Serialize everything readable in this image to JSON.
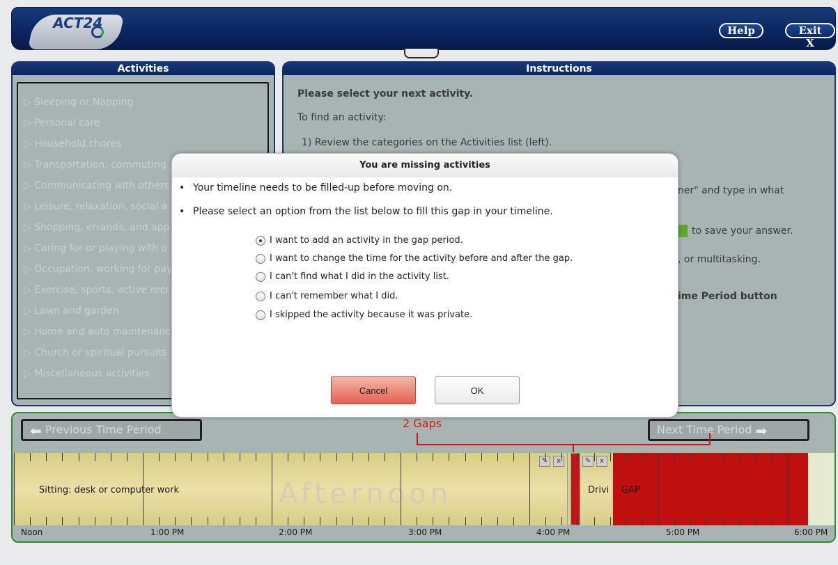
{
  "header": {
    "logo_text": "ACT24",
    "help_label": "Help",
    "exit_label": "Exit X"
  },
  "activities": {
    "title": "Activities",
    "items": [
      "▷ Sleeping or Napping",
      "▷ Personal care",
      "▷ Household chores",
      "▷ Transportation, commuting",
      "▷ Communicating with others",
      "▷ Leisure, relaxation, social a",
      "▷ Shopping, errands, and app",
      "▷ Caring for or playing with o",
      "▷ Occupation, working for pay",
      "▷ Exercise, sports, active recr",
      "▷ Lawn and garden",
      "▷ Home and auto maintenanc",
      "▷ Church or spiritual pursuits",
      "▷ Miscellaneous activities"
    ]
  },
  "instructions": {
    "title": "Instructions",
    "line1": "Please select your next activity.",
    "line2": "To find an activity:",
    "line3": "1) Review the categories on the Activities list (left).",
    "frag1": "ner\" and type in what",
    "frag2": "to save your answer.",
    "frag3": ", or multitasking.",
    "frag4": "ime Period button"
  },
  "modal": {
    "title": "You are missing activities",
    "bullet1": "Your timeline needs to be filled-up before moving on.",
    "bullet2": "Please select an option from the list below to fill this gap in your timeline.",
    "options": [
      "I want to add an activity in the gap period.",
      "I want to change the time for the activity before and after the gap.",
      "I can't find what I did in the activity list.",
      "I can't remember what I did.",
      "I skipped the activity because it was private."
    ],
    "selected_option": 0,
    "cancel_label": "Cancel",
    "ok_label": "OK"
  },
  "timeline": {
    "prev_label": "Previous Time Period",
    "next_label": "Next Time Period",
    "gaps_label": "2 Gaps",
    "period_watermark": "Afternoon",
    "segments": {
      "sitting": "Sitting: desk or computer work",
      "driving": "Drivi",
      "gap": "GAP"
    },
    "time_labels": [
      "Noon",
      "1:00 PM",
      "2:00 PM",
      "3:00 PM",
      "4:00 PM",
      "5:00 PM",
      "6:00 PM"
    ],
    "edit_icon": "pencil-icon",
    "delete_icon_label": "x"
  },
  "colors": {
    "header_blue": "#0a2560",
    "gap_red": "#c00f0f",
    "panel_gray": "#a8b4b4",
    "timeline_border_green": "#2e8a2e"
  }
}
